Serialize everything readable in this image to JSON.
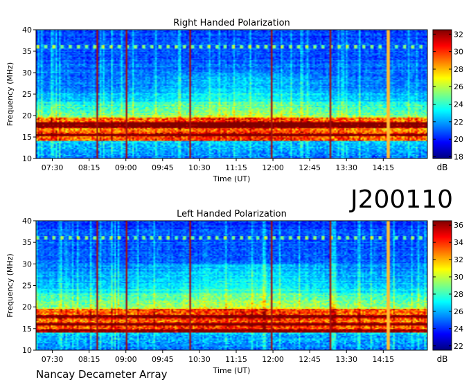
{
  "figure": {
    "obs_id": "J200110",
    "instrument": "Nancay Decameter Array"
  },
  "chart_data": [
    {
      "type": "heatmap",
      "title": "Right Handed Polarization",
      "xlabel": "Time (UT)",
      "ylabel": "Frequency (MHz)",
      "x_ticks": [
        "07:30",
        "08:15",
        "09:00",
        "09:45",
        "10:30",
        "11:15",
        "12:00",
        "12:45",
        "13:30",
        "14:15"
      ],
      "x_tick_minutes": [
        450,
        495,
        540,
        585,
        630,
        675,
        720,
        765,
        810,
        855
      ],
      "xlim_minutes": [
        430,
        909
      ],
      "ylim": [
        10,
        40
      ],
      "y_ticks": [
        10,
        15,
        20,
        25,
        30,
        35,
        40
      ],
      "colorbar": {
        "label": "dB",
        "range": [
          17.8,
          32.5
        ],
        "ticks": [
          18,
          20,
          22,
          24,
          26,
          28,
          30,
          32
        ]
      },
      "colormap": [
        "#000080",
        "#0000ff",
        "#0080ff",
        "#00ffff",
        "#80ff80",
        "#ffff00",
        "#ff8000",
        "#ff0000",
        "#800000"
      ],
      "dark_bands_mhz": [
        15.5,
        17.5,
        18.2
      ],
      "bright_lines_minutes": [
        503,
        539,
        617,
        717,
        790,
        860
      ]
    },
    {
      "type": "heatmap",
      "title": "Left Handed Polarization",
      "xlabel": "Time (UT)",
      "ylabel": "Frequency (MHz)",
      "x_ticks": [
        "07:30",
        "08:15",
        "09:00",
        "09:45",
        "10:30",
        "11:15",
        "12:00",
        "12:45",
        "13:30",
        "14:15"
      ],
      "x_tick_minutes": [
        450,
        495,
        540,
        585,
        630,
        675,
        720,
        765,
        810,
        855
      ],
      "xlim_minutes": [
        430,
        909
      ],
      "ylim": [
        10,
        40
      ],
      "y_ticks": [
        10,
        15,
        20,
        25,
        30,
        35,
        40
      ],
      "colorbar": {
        "label": "dB",
        "range": [
          21.5,
          36.5
        ],
        "ticks": [
          22,
          24,
          26,
          28,
          30,
          32,
          34,
          36
        ]
      },
      "colormap": [
        "#000080",
        "#0000ff",
        "#0080ff",
        "#00ffff",
        "#80ff80",
        "#ffff00",
        "#ff8000",
        "#ff0000",
        "#800000"
      ],
      "dark_bands_mhz": [
        14.5,
        16.0,
        17.8
      ],
      "bright_lines_minutes": [
        503,
        539,
        617,
        717,
        790,
        860
      ]
    }
  ]
}
